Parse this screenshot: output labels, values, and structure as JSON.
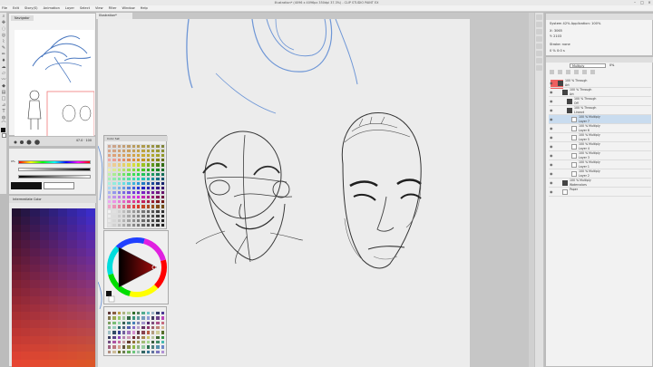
{
  "window": {
    "title": "Illustration* (4096 x 4096px 350dpi 37.3%) - CLIP STUDIO PAINT EX"
  },
  "menu": [
    "File",
    "Edit",
    "Story(S)",
    "Animation",
    "Layer",
    "Select",
    "View",
    "Filter",
    "Window",
    "Help"
  ],
  "navigator": {
    "tab": "Navigator"
  },
  "brush": {
    "size": "47.0",
    "opacity": "100"
  },
  "color_slider": {
    "r": "0%",
    "g": "0%",
    "b": "0%"
  },
  "gradient_palette": {
    "title": "Intermediate Color"
  },
  "document": {
    "tab": "Illustration*"
  },
  "color_set": {
    "title": "Color Set"
  },
  "tool_property": {
    "line1": "System 42% Application: 100%",
    "line2": "X: 3065",
    "line3": "Y: 2103",
    "line4": "Stroke: none",
    "line5": "0 %  0:0 s"
  },
  "layer_panel": {
    "blend_mode": "Multiply",
    "opacity": "0%",
    "layers": [
      {
        "name": "100 % Through",
        "sub": "Art",
        "type": "folder",
        "indent": 0,
        "selected": false
      },
      {
        "name": "100 % Through",
        "sub": "Art",
        "type": "folder",
        "indent": 1,
        "selected": false
      },
      {
        "name": "100 % Through",
        "sub": "Off",
        "type": "folder",
        "indent": 2,
        "selected": false
      },
      {
        "name": "100 % Through",
        "sub": "Lineart",
        "type": "folder",
        "indent": 2,
        "selected": false
      },
      {
        "name": "100 % Multiply",
        "sub": "Layer 7",
        "type": "raster",
        "indent": 3,
        "selected": true
      },
      {
        "name": "100 % Multiply",
        "sub": "Layer 6",
        "type": "raster",
        "indent": 3,
        "selected": false
      },
      {
        "name": "100 % Multiply",
        "sub": "Layer 5",
        "type": "raster",
        "indent": 3,
        "selected": false
      },
      {
        "name": "100 % Multiply",
        "sub": "Layer 4",
        "type": "raster",
        "indent": 3,
        "selected": false
      },
      {
        "name": "100 % Multiply",
        "sub": "Layer 3",
        "type": "raster",
        "indent": 3,
        "selected": false
      },
      {
        "name": "100 % Multiply",
        "sub": "Layer 1",
        "type": "raster",
        "indent": 3,
        "selected": false
      },
      {
        "name": "100 % Multiply",
        "sub": "Layer 2",
        "type": "raster",
        "indent": 3,
        "selected": false
      },
      {
        "name": "100 % Multiply",
        "sub": "Watercolors",
        "type": "folder",
        "indent": 1,
        "selected": false
      },
      {
        "name": "Paper",
        "sub": "",
        "type": "raster",
        "indent": 1,
        "selected": false
      }
    ]
  }
}
